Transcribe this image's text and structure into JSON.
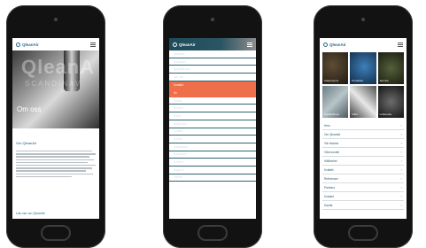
{
  "brand": {
    "name": "QleanAir"
  },
  "phone1": {
    "hero_brand_big": "QleanA",
    "hero_brand_sub": "SCANDINAV",
    "hero_title": "Om oss",
    "intro_title": "Om QleanAir",
    "footer_link": "Läs mer om QleanAir"
  },
  "phone2": {
    "menu_top": [
      "Startsida",
      "Produkter",
      "Applikationer",
      "Om oss"
    ],
    "active": [
      "Kontakt",
      "Sv"
    ],
    "menu_bottom": [
      "Karriär",
      "Nyheter",
      "Press",
      "Miljöpolicy",
      "Kvalitet",
      "Partner",
      "Investerare",
      "Dokument",
      "Service",
      "Logga in",
      "Länkar"
    ]
  },
  "phone3": {
    "tiles": [
      "Cleanrooms",
      "Produkter",
      "Service",
      "Applikationer",
      "Filter",
      "Luftrenare"
    ],
    "list": [
      "Hem",
      "Om QleanAir",
      "Vår historia",
      "Våra kunder",
      "Hållbarhet",
      "Kvalitet",
      "Referenser",
      "Partners",
      "Kontakt",
      "Karriär"
    ]
  },
  "colors": {
    "menu_bg": "#143a48",
    "accent": "#ef6f4a",
    "brand": "#2b6a8a"
  }
}
